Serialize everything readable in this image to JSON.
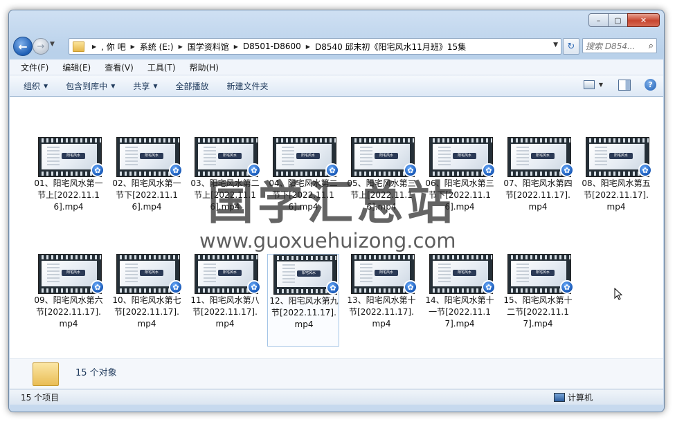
{
  "window": {
    "caption_buttons": {
      "minimize": "–",
      "maximize": "▢",
      "close": "✕"
    }
  },
  "nav": {
    "back_glyph": "←",
    "forward_glyph": "→",
    "breadcrumb": [
      ", 你  吧",
      "系统 (E:)",
      "国学资料馆",
      "D8501-D8600",
      "D8540 邱末初《阳宅风水11月班》15集"
    ],
    "search_placeholder": "搜索 D854...",
    "refresh_glyph": "↻"
  },
  "menubar": [
    "文件(F)",
    "编辑(E)",
    "查看(V)",
    "工具(T)",
    "帮助(H)"
  ],
  "toolbar": {
    "organize": "组织",
    "include_library": "包含到库中",
    "share": "共享",
    "play_all": "全部播放",
    "new_folder": "新建文件夹",
    "help_glyph": "?"
  },
  "thumb_banner": "阳宅风水",
  "files": [
    {
      "name": "01、阳宅风水第一节上[2022.11.16].mp4"
    },
    {
      "name": "02、阳宅风水第一节下[2022.11.16].mp4"
    },
    {
      "name": "03、阳宅风水第二节上[2022.11.16].mp4"
    },
    {
      "name": "04、阳宅风水第二节下[2022.11.16].mp4"
    },
    {
      "name": "05、阳宅风水第三节上[2022.11.16].mp4"
    },
    {
      "name": "06、阳宅风水第三节下[2022.11.16].mp4"
    },
    {
      "name": "07、阳宅风水第四节[2022.11.17].mp4"
    },
    {
      "name": "08、阳宅风水第五节[2022.11.17].mp4"
    },
    {
      "name": "09、阳宅风水第六节[2022.11.17].mp4"
    },
    {
      "name": "10、阳宅风水第七节[2022.11.17].mp4"
    },
    {
      "name": "11、阳宅风水第八节[2022.11.17].mp4"
    },
    {
      "name": "12、阳宅风水第九节[2022.11.17].mp4"
    },
    {
      "name": "13、阳宅风水第十节[2022.11.17].mp4"
    },
    {
      "name": "14、阳宅风水第十一节[2022.11.17].mp4"
    },
    {
      "name": "15、阳宅风水第十二节[2022.11.17].mp4"
    }
  ],
  "selected_index": 11,
  "details": {
    "count": "15 个对象"
  },
  "status": {
    "items": "15 个项目",
    "location": "计算机"
  },
  "watermark": {
    "text": "国学汇总站",
    "url": "www.guoxuehuizong.com"
  },
  "colors": {
    "accent": "#1f5fb5",
    "selection_border": "#a3c4e6",
    "close_button": "#c7452f"
  }
}
